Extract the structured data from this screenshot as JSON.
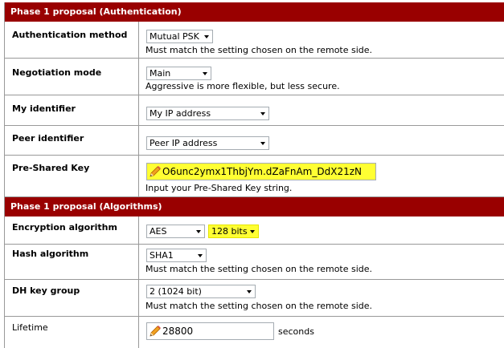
{
  "auth_section": {
    "title": "Phase 1 proposal (Authentication)",
    "authentication_method": {
      "label": "Authentication method",
      "value": "Mutual PSK",
      "hint": "Must match the setting chosen on the remote side."
    },
    "negotiation_mode": {
      "label": "Negotiation mode",
      "value": "Main",
      "hint": "Aggressive is more flexible, but less secure."
    },
    "my_identifier": {
      "label": "My identifier",
      "value": "My IP address"
    },
    "peer_identifier": {
      "label": "Peer identifier",
      "value": "Peer IP address"
    },
    "pre_shared_key": {
      "label": "Pre-Shared Key",
      "value": "O6unc2ymx1ThbjYm.dZaFnAm_DdX21zN",
      "hint": "Input your Pre-Shared Key string."
    }
  },
  "algo_section": {
    "title": "Phase 1 proposal (Algorithms)",
    "encryption_algorithm": {
      "label": "Encryption algorithm",
      "value": "AES",
      "key_length": "128 bits"
    },
    "hash_algorithm": {
      "label": "Hash algorithm",
      "value": "SHA1",
      "hint": "Must match the setting chosen on the remote side."
    },
    "dh_key_group": {
      "label": "DH key group",
      "value": "2 (1024 bit)",
      "hint": "Must match the setting chosen on the remote side."
    },
    "lifetime": {
      "label": "Lifetime",
      "value": "28800",
      "unit": "seconds"
    }
  },
  "colors": {
    "header_bg": "#990000",
    "header_text": "#ffffff",
    "highlight": "#ffff33",
    "border": "#999999"
  },
  "icons": {
    "edit": "pencil-icon",
    "dropdown": "chevron-down-icon"
  }
}
